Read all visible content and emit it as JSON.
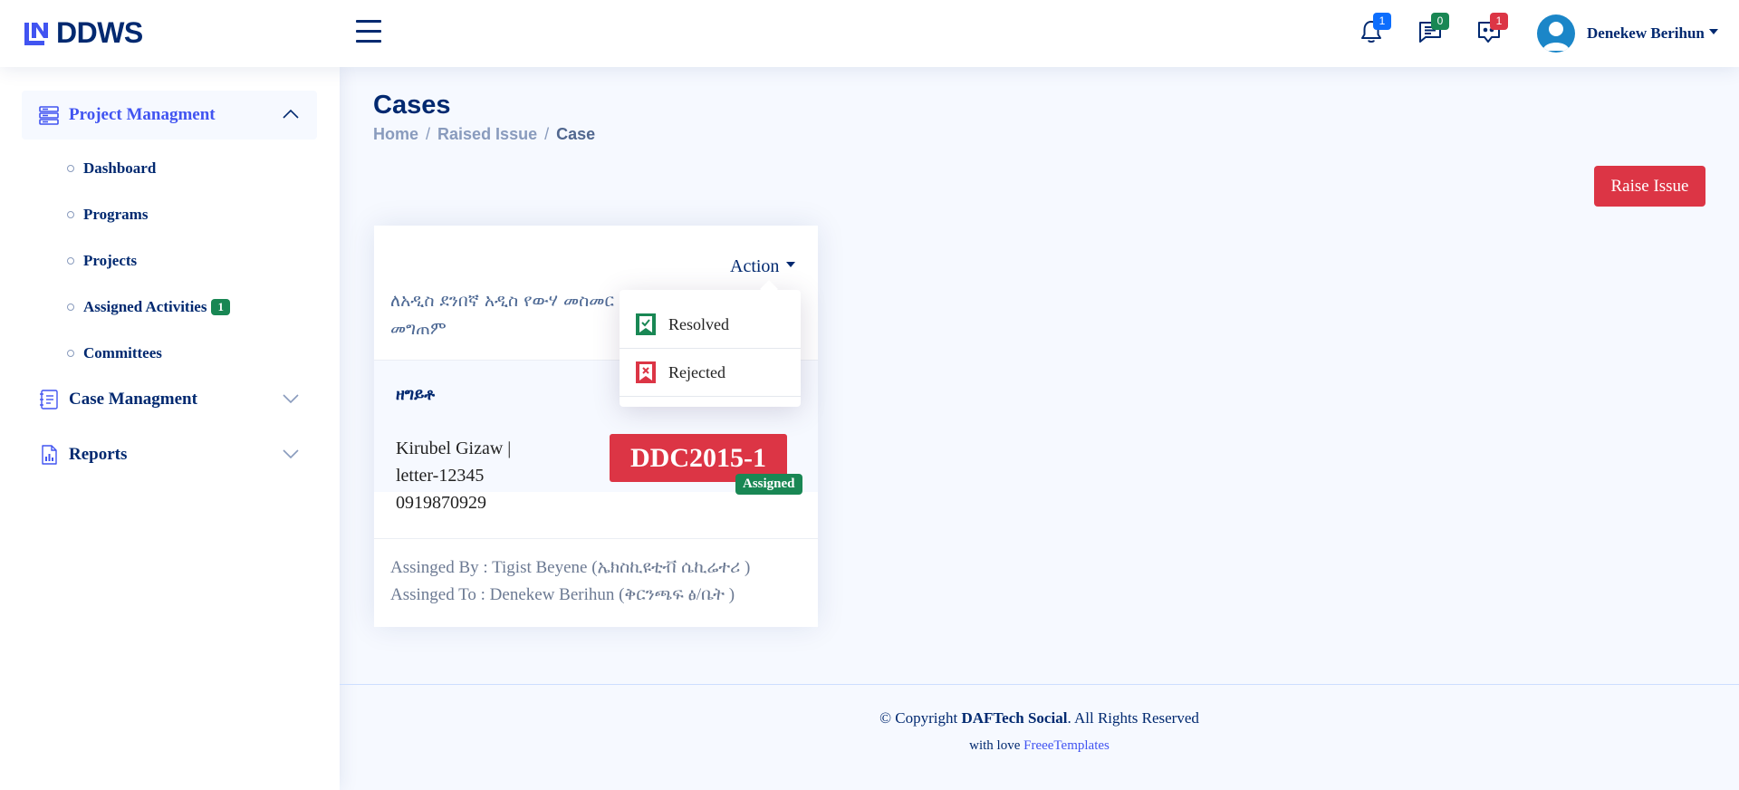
{
  "app": {
    "brand": "DDWS"
  },
  "header": {
    "notifications": {
      "icon": "bell-icon",
      "count": "1",
      "color": "#0d6efd"
    },
    "messages": {
      "icon": "chat-left-text-icon",
      "count": "0",
      "color": "#198754"
    },
    "feedback": {
      "icon": "chat-quote-icon",
      "count": "1",
      "color": "#dc3545"
    },
    "user_name": "Denekew Berihun"
  },
  "sidebar": {
    "project_management": {
      "label": "Project Managment",
      "items": [
        {
          "label": "Dashboard"
        },
        {
          "label": "Programs"
        },
        {
          "label": "Projects"
        },
        {
          "label": "Assigned Activities",
          "badge": "1"
        },
        {
          "label": "Committees"
        }
      ]
    },
    "case_management": {
      "label": "Case Managment"
    },
    "reports": {
      "label": "Reports"
    }
  },
  "page": {
    "title": "Cases",
    "breadcrumb": [
      "Home",
      "Raised Issue",
      "Case"
    ],
    "raise_issue_label": "Raise Issue"
  },
  "case_card": {
    "action_label": "Action",
    "title": "ለአዲስ ደንበኛ አዲስ የውሃ መስመር መግጠም",
    "label": "ዘግይቶ",
    "contact": [
      "Kirubel Gizaw |",
      "letter-12345",
      "0919870929"
    ],
    "case_id": "DDC2015-1",
    "status": "Assigned",
    "assigned_by": "Assinged By : Tigist Beyene (ኤክስኪዩቲቭ ሴኪሬተሪ )",
    "assigned_to": "Assinged To : Denekew Berihun (ቅርንጫፍ ፅ/ቤት )"
  },
  "action_menu": {
    "items": [
      {
        "label": "Resolved",
        "icon": "bookmark-check-icon",
        "color": "#198754"
      },
      {
        "label": "Rejected",
        "icon": "bookmark-x-icon",
        "color": "#dc3545"
      }
    ]
  },
  "footer": {
    "copyright_prefix": "© Copyright ",
    "copyright_brand": "DAFTech Social",
    "copyright_suffix": ". All Rights Reserved",
    "credits_prefix": "with love ",
    "credits_link": "FreeeTemplates"
  }
}
